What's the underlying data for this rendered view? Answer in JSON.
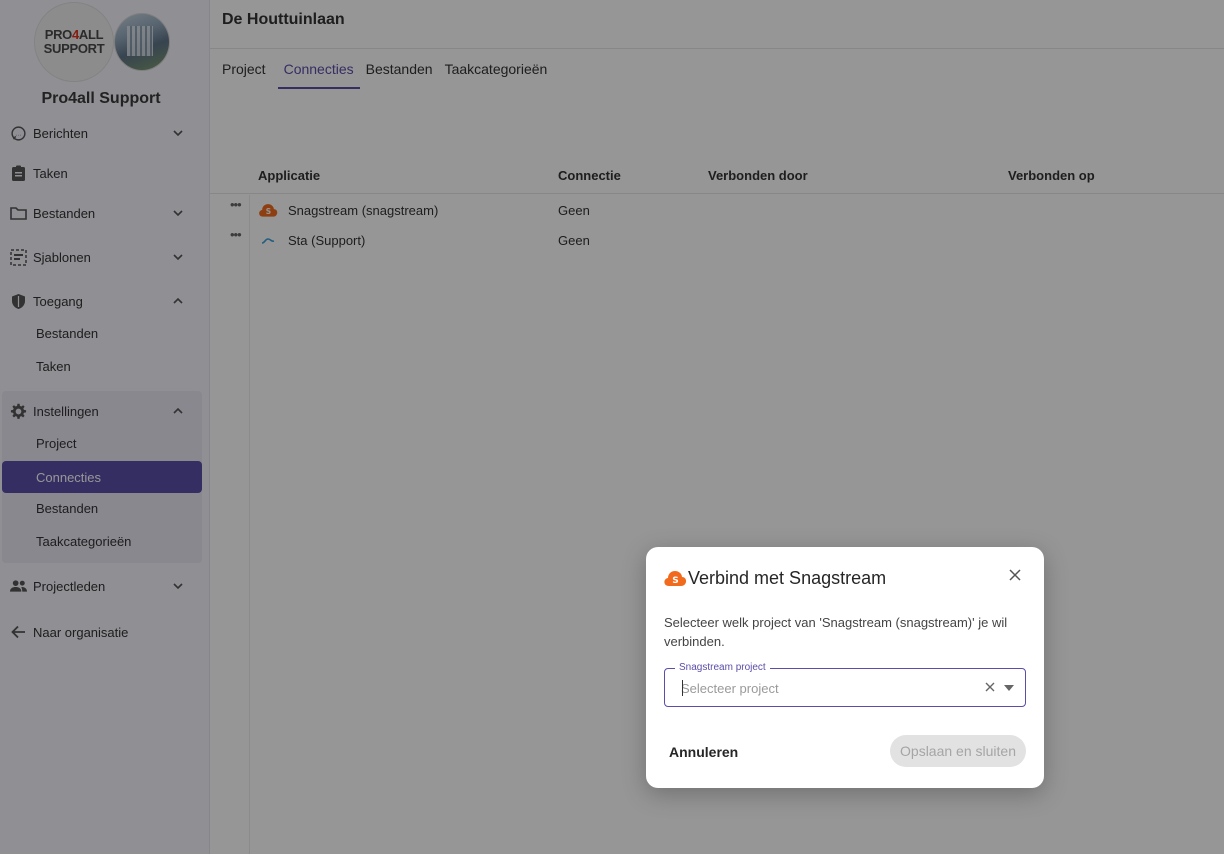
{
  "sidebar": {
    "logo_text_1": "PRO4ALL",
    "logo_text_2": "SUPPORT",
    "org_name": "Pro4all Support",
    "items": [
      {
        "label": "Berichten",
        "icon": "messages-icon",
        "expandable": true,
        "expanded": false
      },
      {
        "label": "Taken",
        "icon": "clipboard-icon",
        "expandable": false
      },
      {
        "label": "Bestanden",
        "icon": "folder-icon",
        "expandable": true,
        "expanded": false
      },
      {
        "label": "Sjablonen",
        "icon": "templates-icon",
        "expandable": true,
        "expanded": false
      },
      {
        "label": "Toegang",
        "icon": "shield-icon",
        "expandable": true,
        "expanded": true
      },
      {
        "label": "Instellingen",
        "icon": "gear-icon",
        "expandable": true,
        "expanded": true
      },
      {
        "label": "Projectleden",
        "icon": "people-icon",
        "expandable": true,
        "expanded": false
      },
      {
        "label": "Naar organisatie",
        "icon": "arrow-left-icon",
        "expandable": false
      }
    ],
    "toegang_sub": [
      "Bestanden",
      "Taken"
    ],
    "instellingen_sub": [
      "Project",
      "Connecties",
      "Bestanden",
      "Taakcategorieën"
    ],
    "active_sub": "Connecties"
  },
  "main": {
    "title": "De Houttuinlaan",
    "tabs": [
      "Project",
      "Connecties",
      "Bestanden",
      "Taakcategorieën"
    ],
    "active_tab": "Connecties",
    "table": {
      "columns": [
        "Applicatie",
        "Connectie",
        "Verbonden door",
        "Verbonden op"
      ],
      "rows": [
        {
          "app": "Snagstream (snagstream)",
          "icon": "snagstream-icon",
          "connectie": "Geen"
        },
        {
          "app": "Sta (Support)",
          "icon": "sta-icon",
          "connectie": "Geen"
        }
      ]
    }
  },
  "dialog": {
    "title": "Verbind met Snagstream",
    "text": "Selecteer welk project van 'Snagstream (snagstream)' je wil verbinden.",
    "field_label": "Snagstream project",
    "field_placeholder": "Selecteer project",
    "cancel_label": "Annuleren",
    "save_label": "Opslaan en sluiten"
  },
  "colors": {
    "accent": "#5a4ea8",
    "snagstream": "#f26b1d",
    "overlay": "rgba(0,0,0,0.41)"
  }
}
